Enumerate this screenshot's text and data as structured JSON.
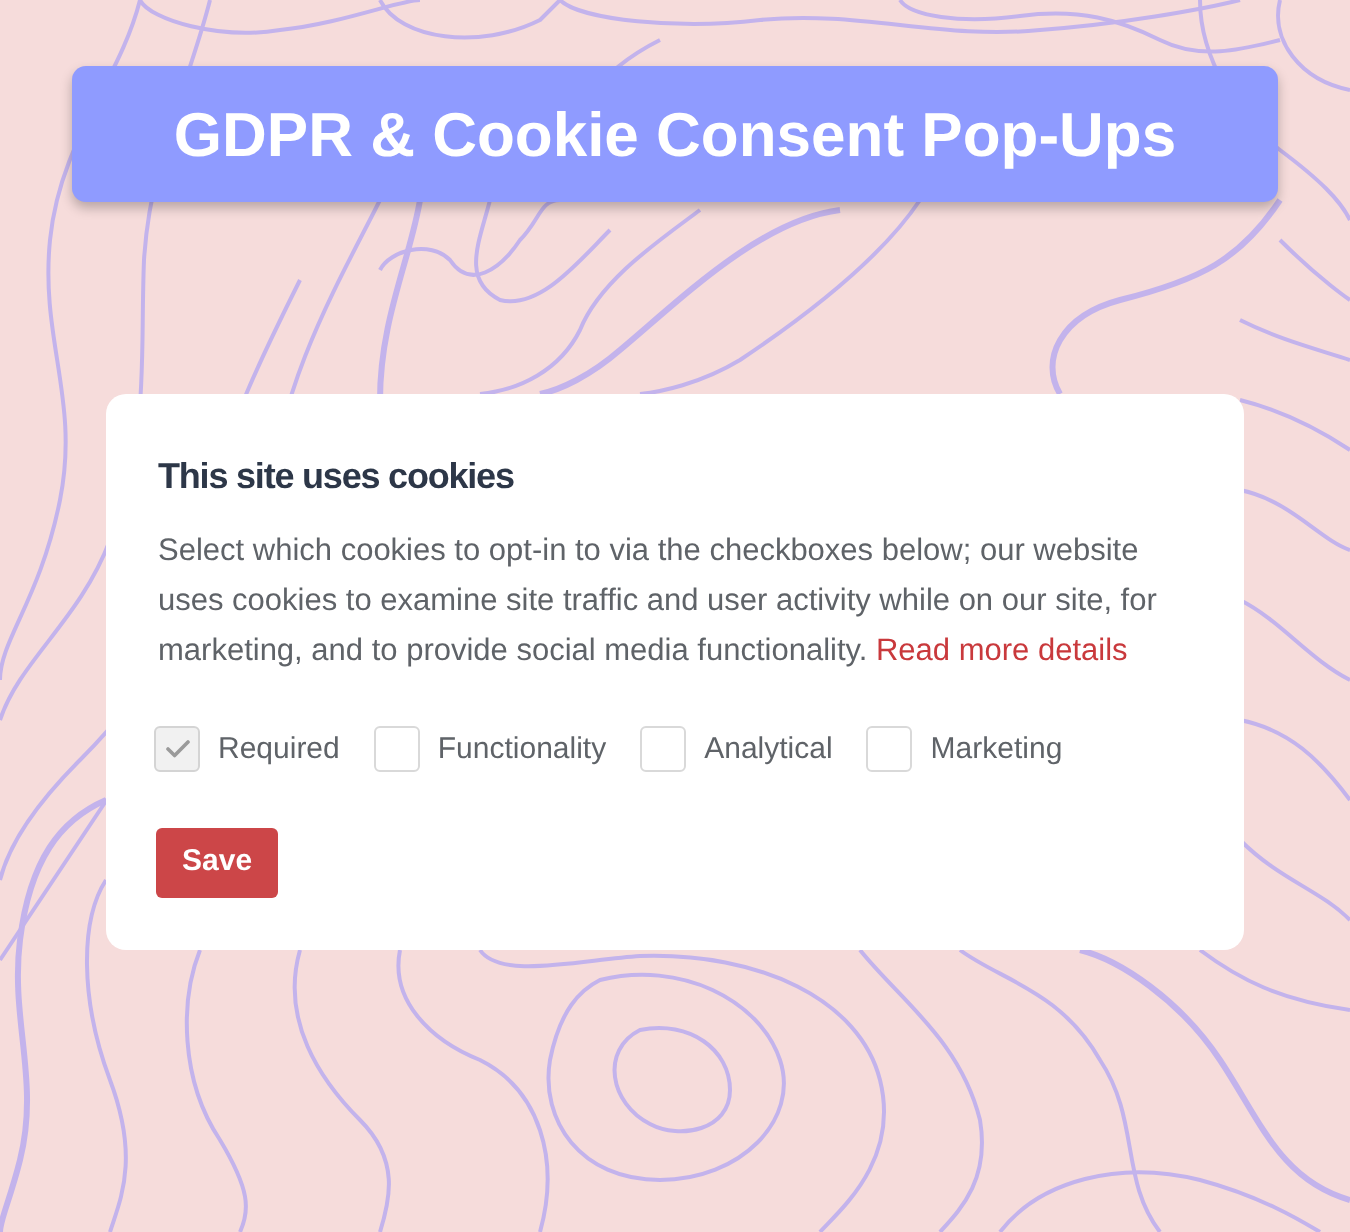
{
  "banner": {
    "title": "GDPR & Cookie Consent Pop-Ups"
  },
  "dialog": {
    "title": "This site uses cookies",
    "message": "Select which cookies to opt-in to via the checkboxes below; our website uses cookies to examine site traffic and user activity while on our site, for marketing, and to provide social media functionality.",
    "link": "Read more details",
    "options": [
      {
        "label": "Required",
        "checked": true,
        "disabled": true
      },
      {
        "label": "Functionality",
        "checked": false,
        "disabled": false
      },
      {
        "label": "Analytical",
        "checked": false,
        "disabled": false
      },
      {
        "label": "Marketing",
        "checked": false,
        "disabled": false
      }
    ],
    "buttons": [
      "Save"
    ]
  }
}
